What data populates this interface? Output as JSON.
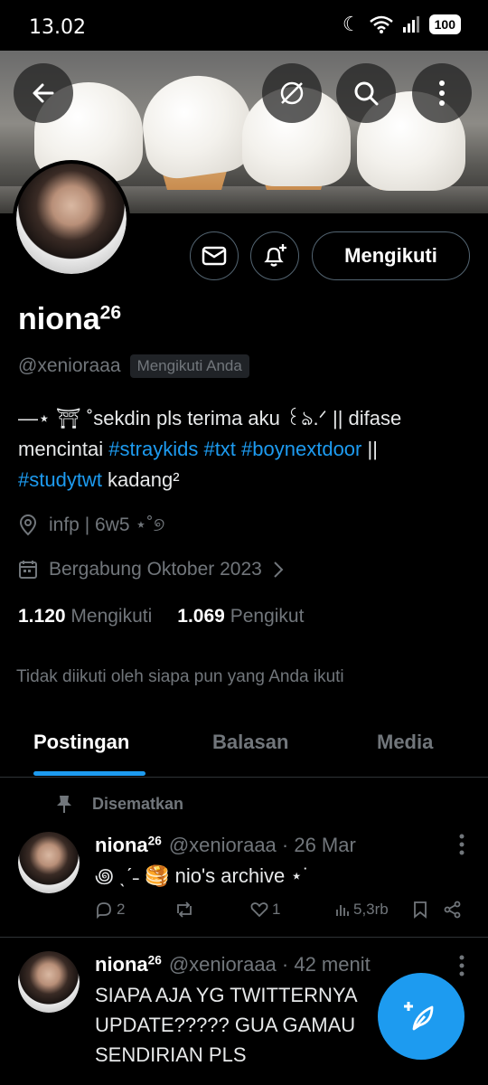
{
  "status_bar": {
    "time": "13.02",
    "battery": "100"
  },
  "profile": {
    "name": "niona",
    "name_sup": "26",
    "handle": "@xenioraaa",
    "follows_you": "Mengikuti Anda",
    "follow_button": "Mengikuti",
    "bio": {
      "line1": "—⋆ ⛩ ˚sekdin pls terima aku ꒰ঌ.ᐟ || difase",
      "line2_prefix": "mencintai ",
      "tag1": "#straykids",
      "tag2": "#txt",
      "tag3": "#boynextdoor",
      "line2_suffix": " ||",
      "tag4": "#studytwt",
      "line3_suffix": " kadang²"
    },
    "location": "infp | 6w5 ⋆˚୭",
    "joined": "Bergabung Oktober 2023",
    "following_count": "1.120",
    "following_label": "Mengikuti",
    "followers_count": "1.069",
    "followers_label": "Pengikut",
    "not_followed": "Tidak diikuti oleh siapa pun yang Anda ikuti"
  },
  "tabs": [
    "Postingan",
    "Balasan",
    "Media"
  ],
  "pinned_label": "Disematkan",
  "tweets": [
    {
      "name": "niona",
      "name_sup": "26",
      "handle": "@xenioraaa · 26 Mar",
      "text": "꩜ ˎˊ˗ 🥞 nio's archive ⋆˙",
      "replies": "2",
      "likes": "1",
      "views": "5,3rb"
    },
    {
      "name": "niona",
      "name_sup": "26",
      "handle": "@xenioraaa · 42 menit",
      "line1": "SIAPA AJA YG TWITTERNYA",
      "line2": "UPDATE????? GUA GAMAU",
      "line3": "SENDIRIAN PLS"
    }
  ],
  "colors": {
    "accent": "#1d9bf0",
    "muted": "#71767b",
    "background": "#000000"
  },
  "icons": [
    "back-arrow-icon",
    "incognito-icon",
    "search-icon",
    "more-vertical-icon",
    "mail-icon",
    "bell-plus-icon",
    "location-pin-icon",
    "calendar-icon",
    "chevron-right-icon",
    "pin-icon",
    "reply-icon",
    "retweet-icon",
    "heart-icon",
    "views-icon",
    "bookmark-icon",
    "share-icon",
    "compose-feather-icon"
  ]
}
